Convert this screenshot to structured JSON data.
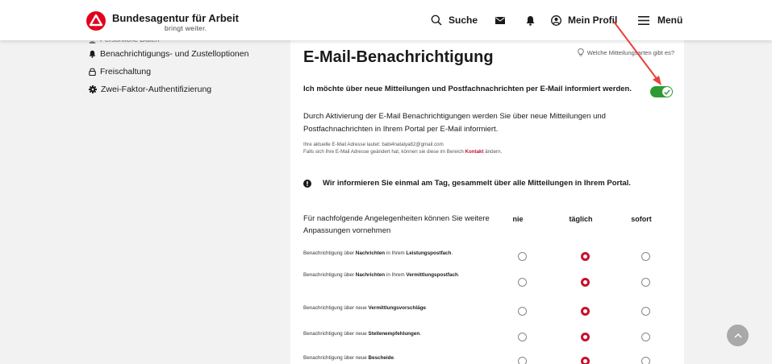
{
  "header": {
    "logo_title": "Bundesagentur für Arbeit",
    "logo_subtitle": "bringt weiter.",
    "search_label": "Suche",
    "profile_label": "Mein Profil",
    "menu_label": "Menü",
    "brand_color": "#e2001a"
  },
  "sidebar": {
    "items": [
      {
        "label": "Persönliche Daten",
        "icon": "person-icon"
      },
      {
        "label": "Benachrichtigungs- und Zustelloptionen",
        "icon": "bell-icon"
      },
      {
        "label": "Freischaltung",
        "icon": "lock-icon"
      },
      {
        "label": "Zwei-Faktor-Authentifizierung",
        "icon": "gear-icon"
      }
    ]
  },
  "main": {
    "title": "E-Mail-Benachrichtigung",
    "help_link": "Welche Mitteilungsarten gibt es?",
    "opt_in_text": "Ich möchte über neue Mitteilungen und Postfachnachrichten per E-Mail informiert werden.",
    "toggle_on": true,
    "toggle_color": "#2f9a33",
    "description": "Durch Aktivierung der E-Mail Benachrichtigungen werden Sie über neue Mitteilungen und Postfachnachrichten in Ihrem Portal per E-Mail informiert.",
    "email_line": "Ihre aktuelle E-Mail Adresse lautet: babi4natalya82@gmail.com",
    "change_line_before": "Falls sich Ihre E-Mail Adresse geändert hat, können sie diese im Bereich ",
    "change_link": "Kontakt",
    "change_line_after": " ändern.",
    "notice": "Wir informieren Sie einmal am Tag, gesammelt über alle Mitteilungen in Ihrem Portal.",
    "matrix_header": "Für nachfolgende Angelegenheiten können Sie weitere Anpassungen vornehmen",
    "columns": [
      "nie",
      "täglich",
      "sofort"
    ],
    "accent_color": "#c8102e",
    "rows": [
      {
        "prefix": "Benachrichtigung über ",
        "b1": "Nachrichten",
        "mid": " in Ihrem ",
        "b2": "Leistungspostfach",
        "suffix": ".",
        "selected": "täglich"
      },
      {
        "prefix": "Benachrichtigung über ",
        "b1": "Nachrichten",
        "mid": " in Ihrem ",
        "b2": "Vermittlungspostfach",
        "suffix": ".",
        "selected": "täglich"
      },
      {
        "prefix": "Benachrichtigung über neue ",
        "b1": "Vermittlungsvorschläge",
        "mid": "",
        "b2": "",
        "suffix": ".",
        "selected": "täglich"
      },
      {
        "prefix": "Benachrichtigung über neue ",
        "b1": "Stellenempfehlungen",
        "mid": "",
        "b2": "",
        "suffix": ".",
        "selected": "täglich"
      },
      {
        "prefix": "Benachrichtigung über neue ",
        "b1": "Bescheide",
        "mid": "",
        "b2": "",
        "suffix": ".",
        "selected": "täglich"
      }
    ]
  }
}
